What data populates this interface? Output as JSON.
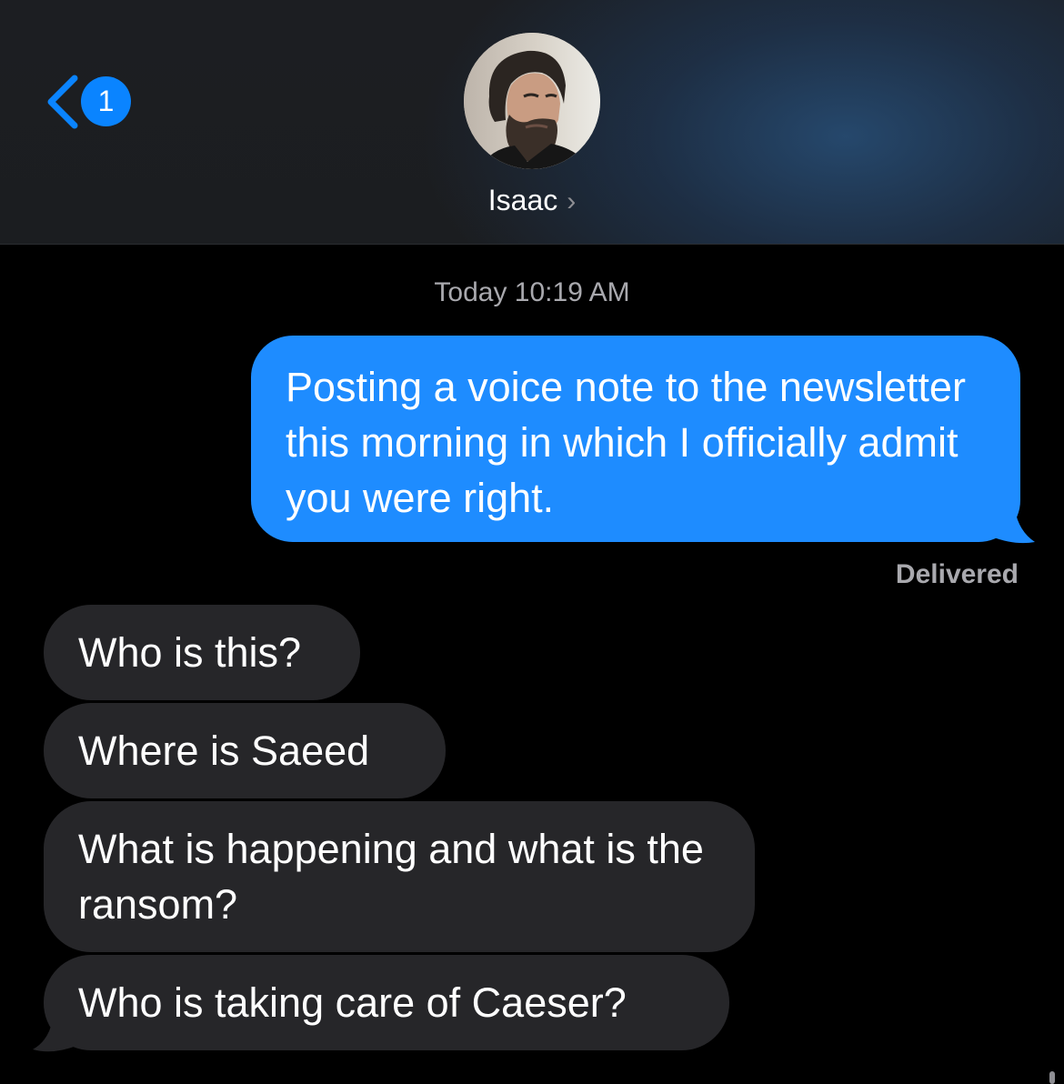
{
  "header": {
    "unread_count": "1",
    "contact_name": "Isaac",
    "contact_chevron": "›",
    "back_icon": "chevron-left-icon"
  },
  "conversation": {
    "timestamp": "Today 10:19 AM",
    "sent_messages": [
      {
        "text": "Posting a voice note to the newsletter this morning in which I officially admit you were right."
      }
    ],
    "delivery_status": "Delivered",
    "received_messages": [
      {
        "text": "Who is this?"
      },
      {
        "text": "Where is Saeed"
      },
      {
        "text": "What is happening and what is the ransom?"
      },
      {
        "text": "Who is taking care of Caeser?"
      }
    ]
  },
  "colors": {
    "accent": "#0a84ff",
    "sent_bubble": "#1e8cff",
    "received_bubble": "#262629",
    "background": "#000000",
    "secondary_text": "#a9a9ae"
  }
}
